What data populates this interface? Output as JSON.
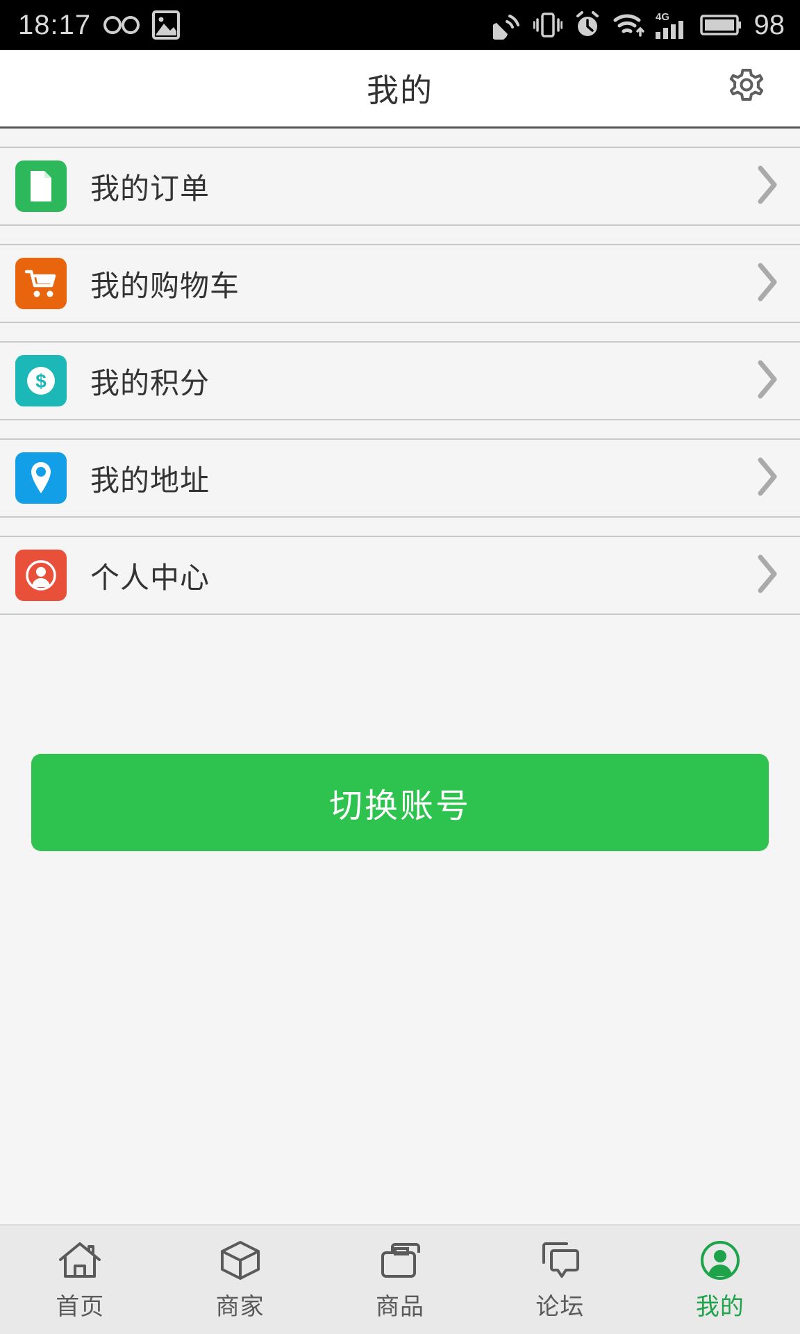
{
  "status_bar": {
    "time": "18:17",
    "battery_percent": "98",
    "left_icons": [
      "infinity-icon",
      "image-icon"
    ],
    "right_icons": [
      "sound-waves-icon",
      "vibrate-icon",
      "alarm-clock-icon",
      "wifi-icon",
      "4g-signal-icon",
      "battery-icon"
    ],
    "network_label": "4G",
    "background": "#000000",
    "foreground": "#d8d8d8"
  },
  "header": {
    "title": "我的",
    "settings_icon": "gear-icon",
    "background": "#ffffff"
  },
  "list": {
    "items": [
      {
        "label": "我的订单",
        "icon": "document-icon",
        "icon_color": "#2eb85c",
        "chevron": "chevron-right-icon"
      },
      {
        "label": "我的购物车",
        "icon": "shopping-cart-icon",
        "icon_color": "#e8650d",
        "chevron": "chevron-right-icon"
      },
      {
        "label": "我的积分",
        "icon": "dollar-coin-icon",
        "icon_color": "#1cb8b8",
        "chevron": "chevron-right-icon"
      },
      {
        "label": "我的地址",
        "icon": "location-pin-icon",
        "icon_color": "#139ee8",
        "chevron": "chevron-right-icon"
      },
      {
        "label": "个人中心",
        "icon": "person-avatar-icon",
        "icon_color": "#e8503a",
        "chevron": "chevron-right-icon"
      }
    ]
  },
  "actions": {
    "switch_account_label": "切换账号",
    "switch_account_color": "#2ec24e"
  },
  "tabbar": {
    "active_color": "#1ea34a",
    "inactive_color": "#5a5a5a",
    "items": [
      {
        "label": "首页",
        "icon": "home-icon",
        "active": false
      },
      {
        "label": "商家",
        "icon": "cube-icon",
        "active": false
      },
      {
        "label": "商品",
        "icon": "bag-icon",
        "active": false
      },
      {
        "label": "论坛",
        "icon": "forum-icon",
        "active": false
      },
      {
        "label": "我的",
        "icon": "profile-icon",
        "active": true
      }
    ]
  }
}
